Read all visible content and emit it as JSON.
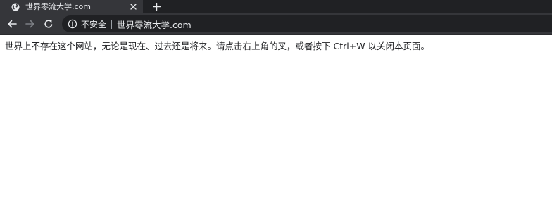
{
  "tab": {
    "title": "世界零流大学.com",
    "icon": "globe-icon"
  },
  "toolbar": {
    "back_icon": "arrow-left-icon",
    "forward_icon": "arrow-right-icon",
    "reload_icon": "reload-icon"
  },
  "omnibox": {
    "security_label": "不安全",
    "url": "世界零流大学.com"
  },
  "page": {
    "message": "世界上不存在这个网站，无论是现在、过去还是将来。请点击右上角的叉，或者按下 Ctrl+W 以关闭本页面。"
  },
  "colors": {
    "tabstrip": "#202124",
    "active_tab": "#35363a",
    "toolbar": "#35363a",
    "omnibox": "#202124",
    "page_background": "#ffffff",
    "text_light": "#e8eaed"
  }
}
